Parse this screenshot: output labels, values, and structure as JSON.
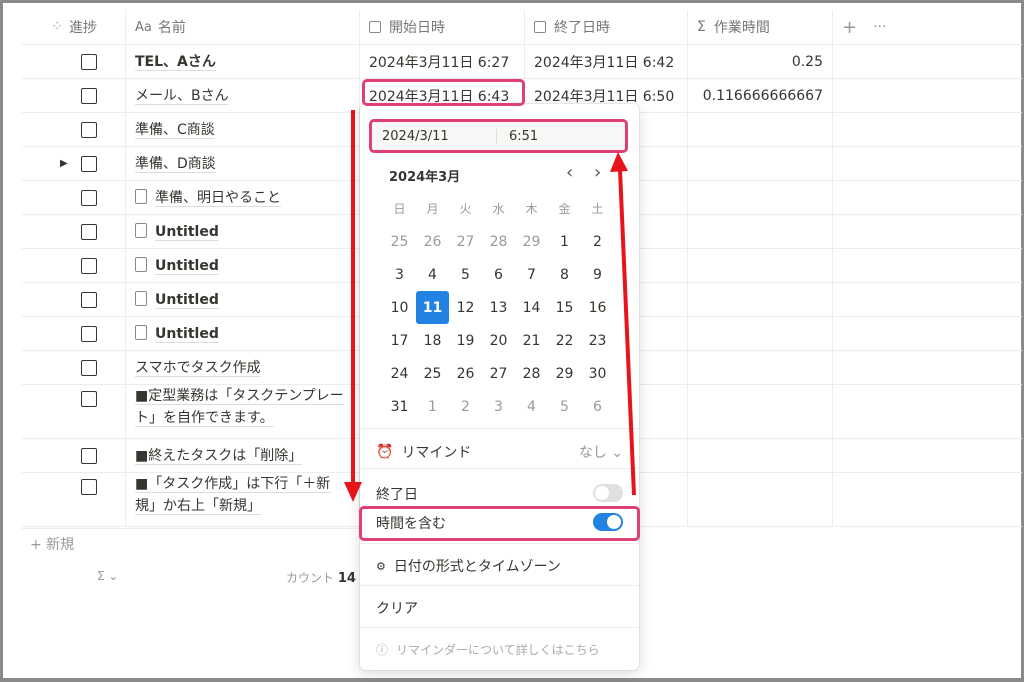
{
  "headers": {
    "progress": "進捗",
    "name_prefix": "Aa",
    "name": "名前",
    "start": "開始日時",
    "end": "終了日時",
    "hours_prefix": "Σ",
    "hours": "作業時間",
    "add": "+",
    "more": "···"
  },
  "rows": [
    {
      "name": "TEL、Aさん",
      "bold": true,
      "start": "2024年3月11日 6:27",
      "end": "2024年3月11日 6:42",
      "hours": "0.25"
    },
    {
      "name": "メール、Bさん",
      "start": "2024年3月11日 6:43",
      "end": "2024年3月11日 6:50",
      "hours": "0.116666666667"
    },
    {
      "name": "準備、C商談"
    },
    {
      "name": "準備、D商談",
      "toggle": true
    },
    {
      "name": "準備、明日やること",
      "doc": true
    },
    {
      "name": "Untitled",
      "doc": true,
      "bold": true
    },
    {
      "name": "Untitled",
      "doc": true,
      "bold": true
    },
    {
      "name": "Untitled",
      "doc": true,
      "bold": true
    },
    {
      "name": "Untitled",
      "doc": true,
      "bold": true
    },
    {
      "name": "スマホでタスク作成"
    },
    {
      "name": "■定型業務は「タスクテンプレート」を自作できます。",
      "tall": true
    },
    {
      "name": "■終えたタスクは「削除」"
    },
    {
      "name": "■「タスク作成」は下行「＋新規」か右上「新規」",
      "tall": true
    }
  ],
  "new_row": "+ 新規",
  "footer": {
    "sigma": "Σ ⌄",
    "count_label": "カウント",
    "count": "14"
  },
  "popup": {
    "date": "2024/3/11",
    "time": "6:51",
    "month": "2024年3月",
    "prev": "‹",
    "next": "›",
    "weekdays": [
      "日",
      "月",
      "火",
      "水",
      "木",
      "金",
      "土"
    ],
    "days": [
      [
        "25",
        "26",
        "27",
        "28",
        "29",
        "1",
        "2"
      ],
      [
        "3",
        "4",
        "5",
        "6",
        "7",
        "8",
        "9"
      ],
      [
        "10",
        "11",
        "12",
        "13",
        "14",
        "15",
        "16"
      ],
      [
        "17",
        "18",
        "19",
        "20",
        "21",
        "22",
        "23"
      ],
      [
        "24",
        "25",
        "26",
        "27",
        "28",
        "29",
        "30"
      ],
      [
        "31",
        "1",
        "2",
        "3",
        "4",
        "5",
        "6"
      ]
    ],
    "selected": "11",
    "remind": "リマインド",
    "remind_value": "なし ⌄",
    "end_date": "終了日",
    "end_date_on": false,
    "include_time": "時間を含む",
    "include_time_on": true,
    "format": "日付の形式とタイムゾーン",
    "clear": "クリア",
    "help": "リマインダーについて詳しくはこちら"
  },
  "colors": {
    "accent": "#2383e2",
    "highlight": "#e0407a",
    "arrow": "#e8141c"
  }
}
